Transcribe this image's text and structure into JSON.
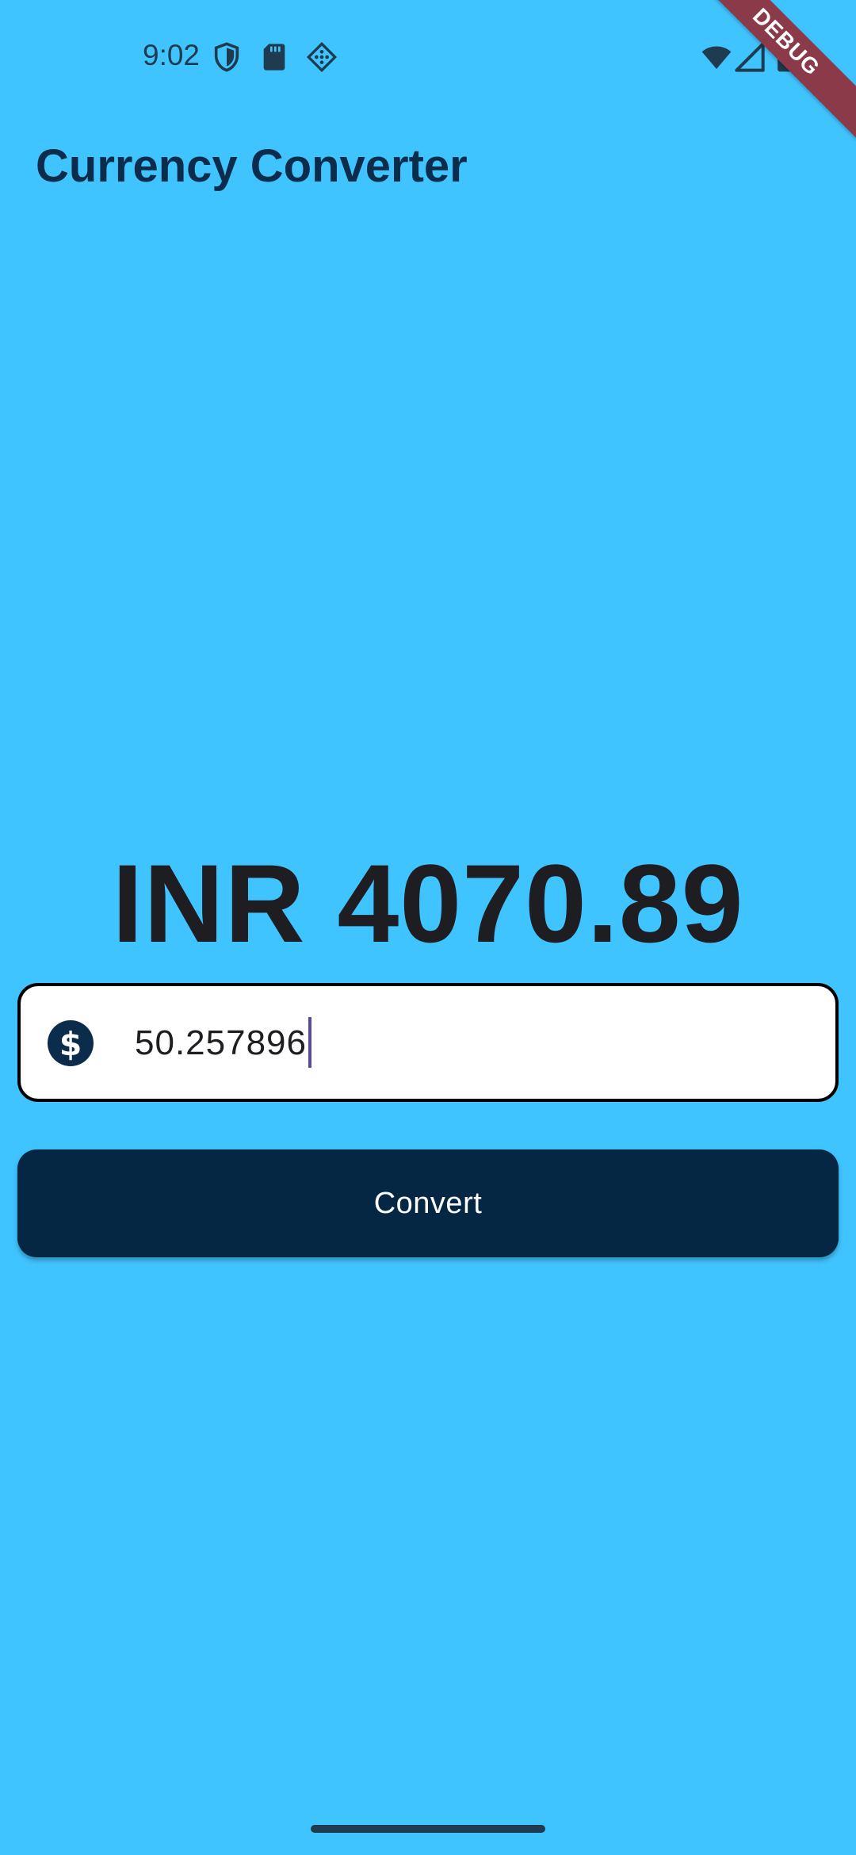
{
  "status_bar": {
    "time": "9:02",
    "left_icons": [
      "shield-icon",
      "sd-card-icon",
      "diamond-grid-icon"
    ],
    "right_icons": [
      "wifi-icon",
      "cellular-signal-icon",
      "battery-icon"
    ]
  },
  "debug_banner": {
    "label": "DEBUG"
  },
  "app_bar": {
    "title": "Currency Converter"
  },
  "result": {
    "text": "INR 4070.89"
  },
  "amount_input": {
    "value": "50.257896",
    "icon": "dollar-circle-icon"
  },
  "convert_button": {
    "label": "Convert"
  },
  "colors": {
    "background": "#40C4FF",
    "title": "#0C2C4C",
    "button": "#062744",
    "ribbon": "#8B3A4A"
  }
}
